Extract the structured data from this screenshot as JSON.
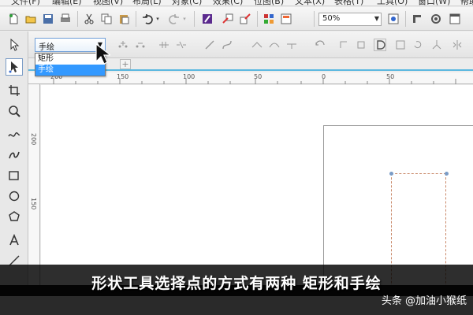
{
  "menu": [
    "文件(F)",
    "编辑(E)",
    "视图(V)",
    "布局(L)",
    "对象(C)",
    "效果(C)",
    "位图(B)",
    "文本(X)",
    "表格(T)",
    "工具(O)",
    "窗口(W)",
    "帮助"
  ],
  "toolbar": {
    "zoom_value": "50%"
  },
  "propbar": {
    "selection_mode_value": "手绘",
    "selection_mode_options": [
      "矩形",
      "手绘"
    ]
  },
  "rulers": {
    "top_labels": [
      "200",
      "150",
      "100",
      "50",
      "0",
      "50"
    ],
    "left_labels": [
      "200",
      "150"
    ]
  },
  "subtitle": "形状工具选择点的方式有两种 矩形和手绘",
  "watermark": "头条 @加油小猴纸"
}
